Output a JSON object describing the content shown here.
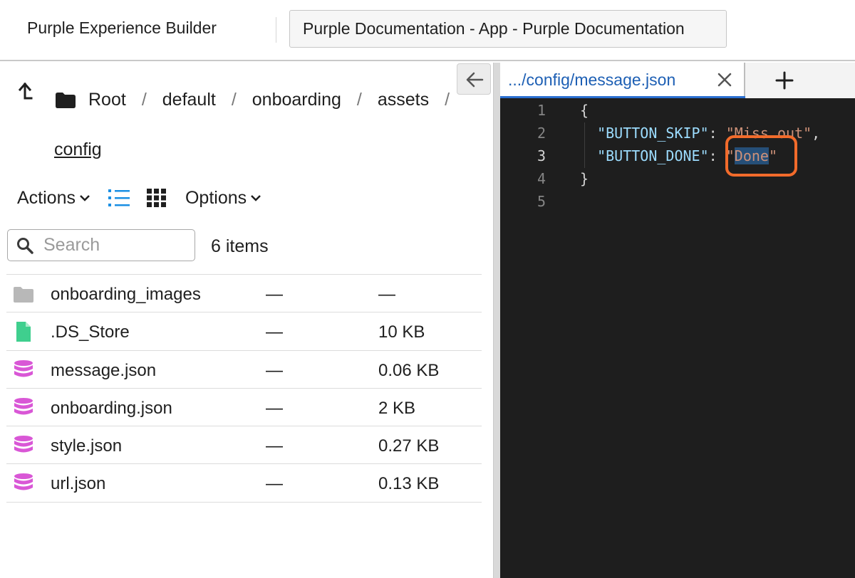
{
  "top_tabs": {
    "app_title": "Purple Experience Builder",
    "active_tab": "Purple Documentation - App - Purple Documentation"
  },
  "breadcrumb": {
    "items": [
      "Root",
      "default",
      "onboarding",
      "assets"
    ],
    "separator": "/",
    "current": "config"
  },
  "toolbar": {
    "actions_label": "Actions",
    "options_label": "Options"
  },
  "search": {
    "placeholder": "Search",
    "value": ""
  },
  "item_count": "6 items",
  "files": [
    {
      "name": "onboarding_images",
      "modified": "—",
      "size": "—",
      "icon": "folder-icon"
    },
    {
      "name": ".DS_Store",
      "modified": "—",
      "size": "10 KB",
      "icon": "file-icon"
    },
    {
      "name": "message.json",
      "modified": "—",
      "size": "0.06 KB",
      "icon": "database-icon"
    },
    {
      "name": "onboarding.json",
      "modified": "—",
      "size": "2 KB",
      "icon": "database-icon"
    },
    {
      "name": "style.json",
      "modified": "—",
      "size": "0.27 KB",
      "icon": "database-icon"
    },
    {
      "name": "url.json",
      "modified": "—",
      "size": "0.13 KB",
      "icon": "database-icon"
    }
  ],
  "editor": {
    "tab_label": ".../config/message.json",
    "active_line": 3,
    "line_numbers": [
      "1",
      "2",
      "3",
      "4",
      "5"
    ],
    "code": {
      "open_brace": "{",
      "line2_key": "\"BUTTON_SKIP\"",
      "line2_colon": ": ",
      "line2_value": "\"Miss out\"",
      "line2_comma": ",",
      "line3_key": "\"BUTTON_DONE\"",
      "line3_colon": ": ",
      "line3_value_quote_open": "\"",
      "line3_value_text": "Done",
      "line3_value_quote_close": "\"",
      "close_brace": "}"
    }
  },
  "colors": {
    "accent_blue": "#1a8fe3",
    "json_icon": "#d957d6",
    "file_icon": "#3fcf8e",
    "folder_icon": "#b8b8b8",
    "highlight_box": "#f26b2b",
    "editor_bg": "#1e1e1e"
  }
}
